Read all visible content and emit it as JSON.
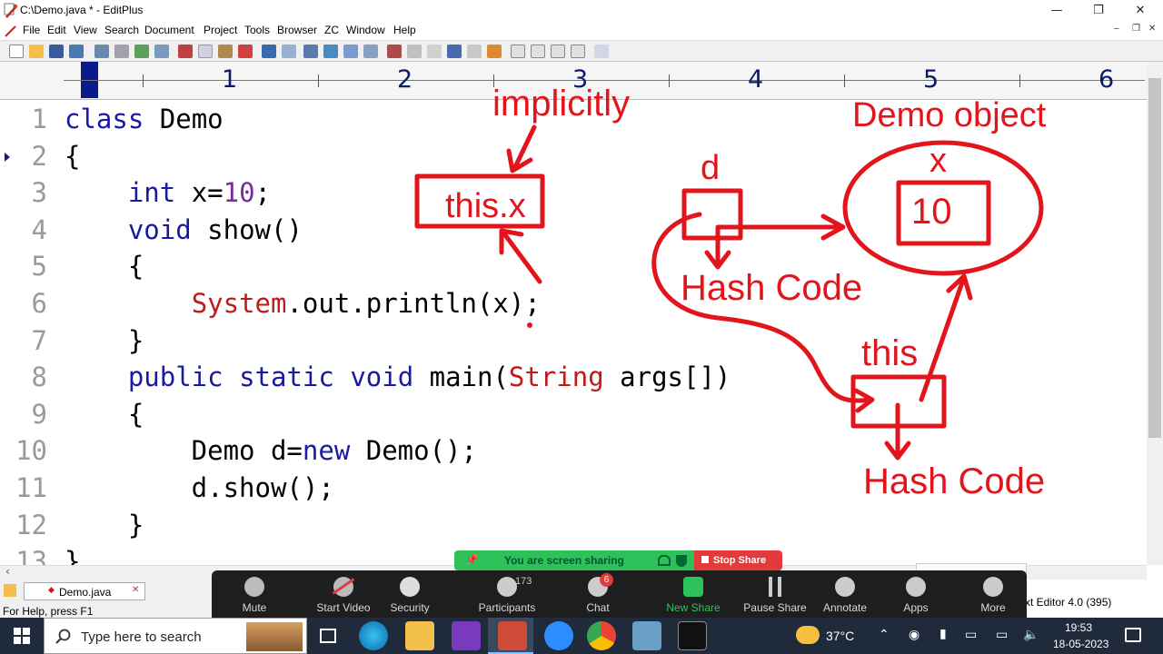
{
  "window": {
    "title": "C:\\Demo.java * - EditPlus",
    "minimize": "—",
    "maximize": "❐",
    "close": "✕"
  },
  "menu": [
    "File",
    "Edit",
    "View",
    "Search",
    "Document",
    "Project",
    "Tools",
    "Browser",
    "ZC",
    "Window",
    "Help"
  ],
  "ruler": [
    "1",
    "2",
    "3",
    "4",
    "5",
    "6"
  ],
  "editor": {
    "line_numbers": [
      "1",
      "2",
      "3",
      "4",
      "5",
      "6",
      "7",
      "8",
      "9",
      "10",
      "11",
      "12",
      "13"
    ],
    "lines": [
      [
        {
          "t": "class",
          "c": "kw"
        },
        {
          "t": " Demo",
          "c": ""
        }
      ],
      [
        {
          "t": "{",
          "c": ""
        }
      ],
      [
        {
          "t": "    ",
          "c": ""
        },
        {
          "t": "int",
          "c": "kw"
        },
        {
          "t": " x=",
          "c": ""
        },
        {
          "t": "10",
          "c": "num10"
        },
        {
          "t": ";",
          "c": ""
        }
      ],
      [
        {
          "t": "    ",
          "c": ""
        },
        {
          "t": "void",
          "c": "kw"
        },
        {
          "t": " show()",
          "c": ""
        }
      ],
      [
        {
          "t": "    {",
          "c": ""
        }
      ],
      [
        {
          "t": "        ",
          "c": ""
        },
        {
          "t": "System",
          "c": "cls"
        },
        {
          "t": ".out.println(x);",
          "c": ""
        }
      ],
      [
        {
          "t": "    }",
          "c": ""
        }
      ],
      [
        {
          "t": "    ",
          "c": ""
        },
        {
          "t": "public",
          "c": "kw"
        },
        {
          "t": " ",
          "c": ""
        },
        {
          "t": "static",
          "c": "kw"
        },
        {
          "t": " ",
          "c": ""
        },
        {
          "t": "void",
          "c": "kw"
        },
        {
          "t": " main(",
          "c": ""
        },
        {
          "t": "String",
          "c": "cls"
        },
        {
          "t": " args[])",
          "c": ""
        }
      ],
      [
        {
          "t": "    {",
          "c": ""
        }
      ],
      [
        {
          "t": "        Demo d=",
          "c": ""
        },
        {
          "t": "new",
          "c": "kw"
        },
        {
          "t": " Demo();",
          "c": ""
        }
      ],
      [
        {
          "t": "        d.show();",
          "c": ""
        }
      ],
      [
        {
          "t": "    }",
          "c": ""
        }
      ],
      [
        {
          "t": "}",
          "c": ""
        }
      ]
    ]
  },
  "annotations": {
    "implicitly": "implicitly",
    "this_x": "this.x",
    "demo_object": "Demo object",
    "x": "x",
    "ten": "10",
    "d": "d",
    "hash_code_1": "Hash Code",
    "this": "this",
    "hash_code_2": "Hash Code"
  },
  "file_tab": "Demo.java",
  "status": {
    "left": "For Help, press F1",
    "right": "xt Editor 4.0 (395)"
  },
  "share_banner": {
    "text": "You are screen sharing",
    "stop": "Stop Share"
  },
  "zoom_controls": [
    {
      "label": "Mute",
      "icon": "microphone-icon"
    },
    {
      "label": "Start Video",
      "icon": "video-off-icon"
    },
    {
      "label": "Security",
      "icon": "shield-icon"
    },
    {
      "label": "Participants",
      "icon": "participants-icon",
      "count": "173"
    },
    {
      "label": "Chat",
      "icon": "chat-icon",
      "badge": "6"
    },
    {
      "label": "New Share",
      "icon": "share-icon"
    },
    {
      "label": "Pause Share",
      "icon": "pause-icon"
    },
    {
      "label": "Annotate",
      "icon": "pen-icon"
    },
    {
      "label": "Apps",
      "icon": "apps-icon"
    },
    {
      "label": "More",
      "icon": "more-icon"
    }
  ],
  "taskbar": {
    "search_placeholder": "Type here to search",
    "temperature": "37°C",
    "time": "19:53",
    "date": "18-05-2023"
  },
  "colors": {
    "annotation_red": "#e3151c",
    "keyword_blue": "#1a1aa0",
    "zoom_green": "#2ec15a",
    "zoom_red": "#e23b3b"
  }
}
